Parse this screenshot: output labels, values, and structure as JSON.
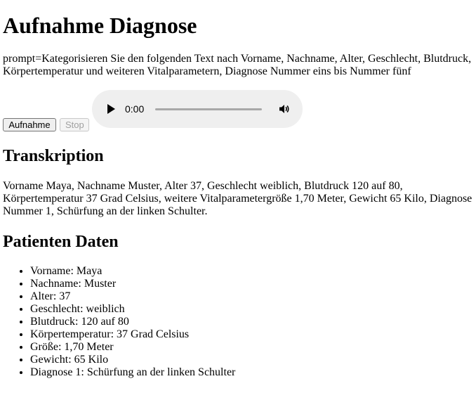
{
  "title": "Aufnahme Diagnose",
  "prompt": "prompt=Kategorisieren Sie den folgenden Text nach Vorname, Nachname, Alter, Geschlecht, Blutdruck, Körpertemperatur und weiteren Vitalparametern, Diagnose Nummer eins bis Nummer fünf",
  "controls": {
    "record_label": "Aufnahme",
    "stop_label": "Stop",
    "audio": {
      "time": "0:00",
      "progress": 0,
      "play_icon": "play-icon",
      "volume_icon": "volume-icon"
    }
  },
  "transcription": {
    "heading": "Transkription",
    "text": "Vorname Maya, Nachname Muster, Alter 37, Geschlecht weiblich, Blutdruck 120 auf 80, Körpertemperatur 37 Grad Celsius, weitere Vitalparametergröße 1,70 Meter, Gewicht 65 Kilo, Diagnose Nummer 1, Schürfung an der linken Schulter."
  },
  "patient": {
    "heading": "Patienten Daten",
    "items": [
      "Vorname: Maya",
      "Nachname: Muster",
      "Alter: 37",
      "Geschlecht: weiblich",
      "Blutdruck: 120 auf 80",
      "Körpertemperatur: 37 Grad Celsius",
      "Größe: 1,70 Meter",
      "Gewicht: 65 Kilo",
      "Diagnose 1: Schürfung an der linken Schulter"
    ]
  }
}
